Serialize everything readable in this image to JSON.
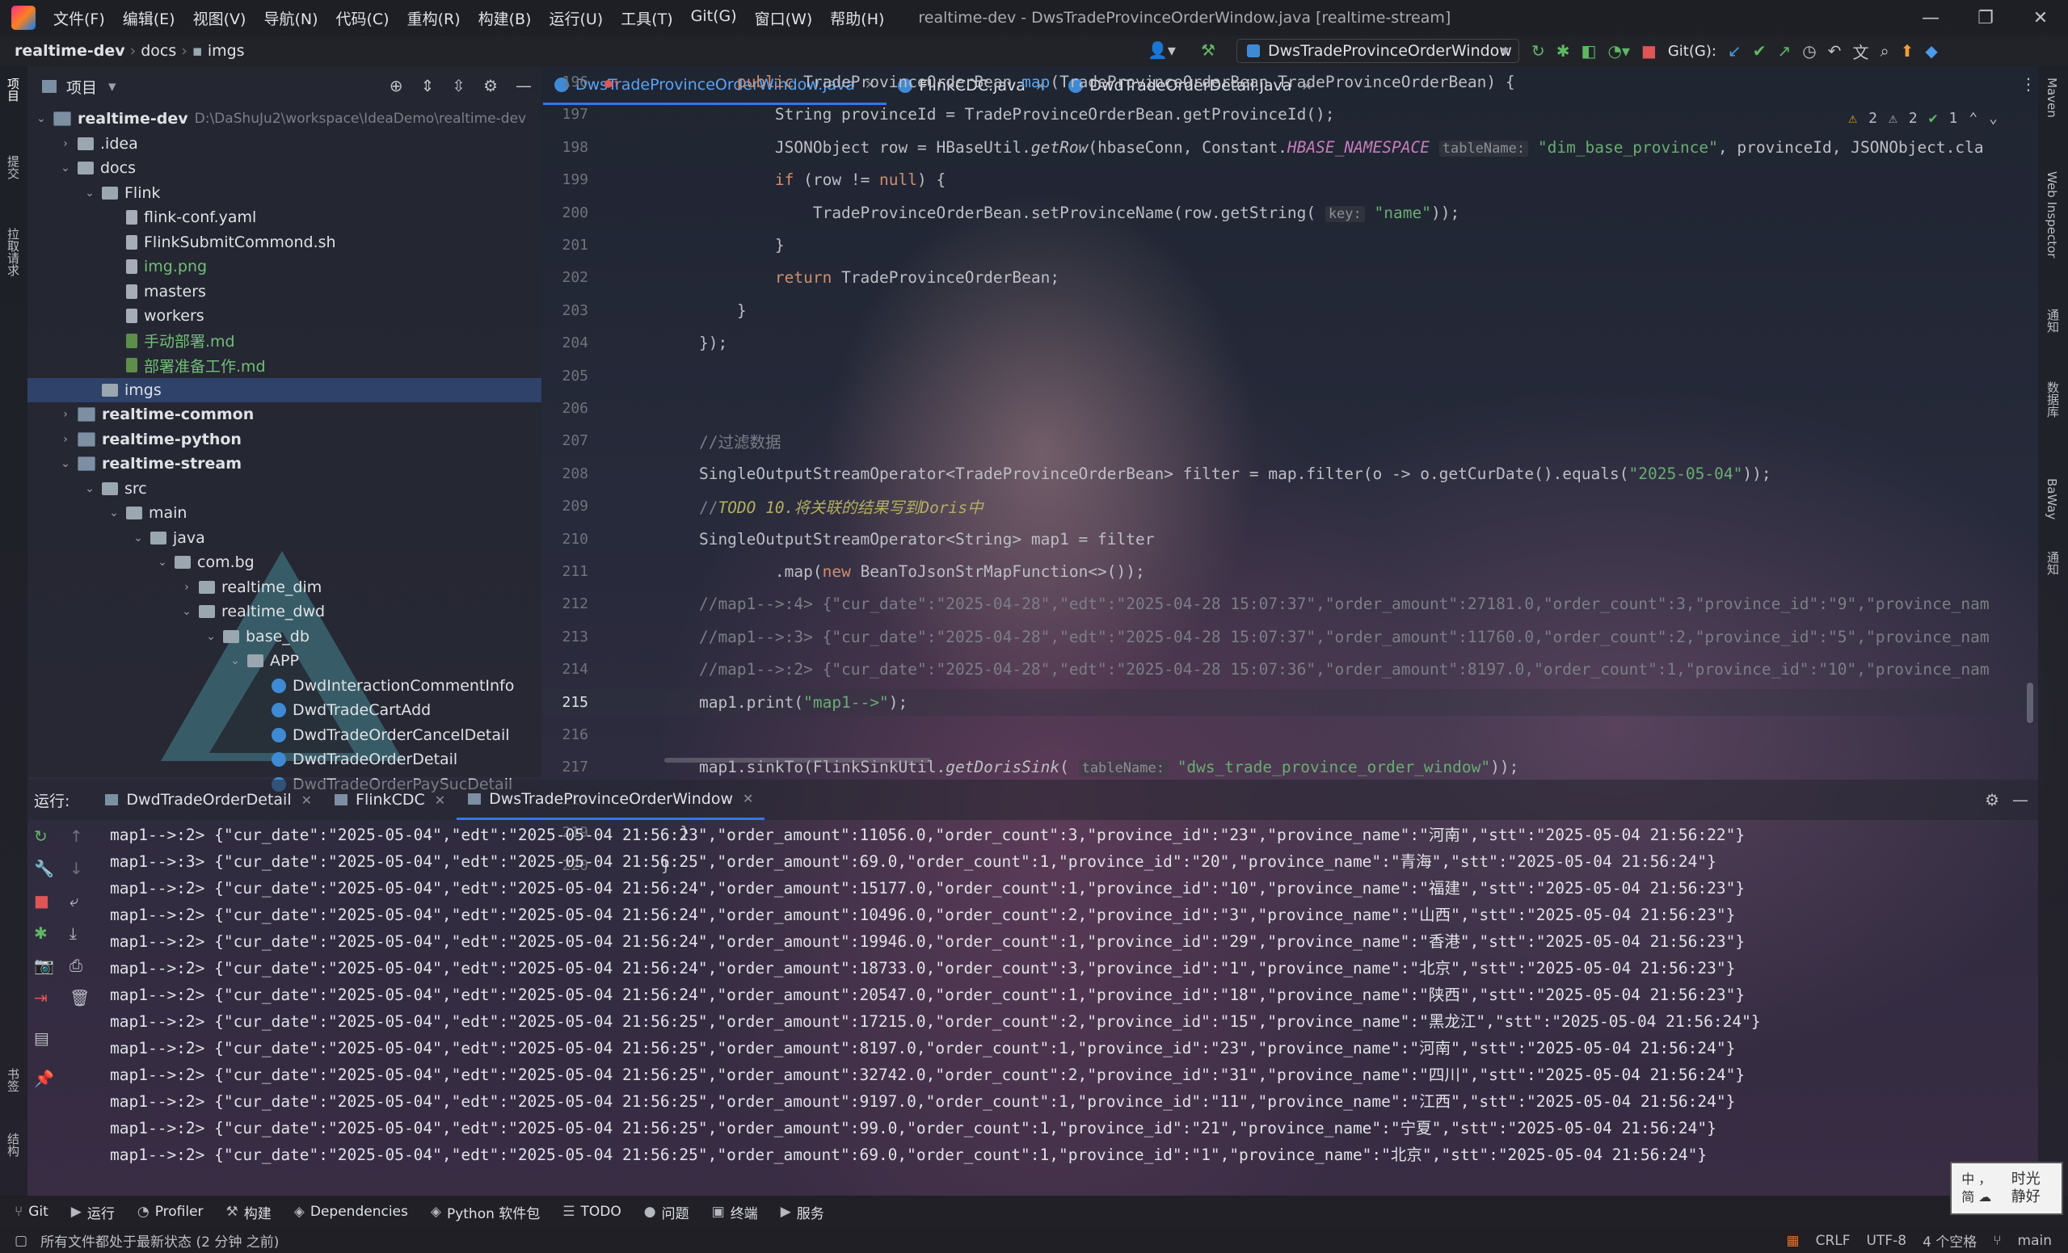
{
  "window": {
    "title": "realtime-dev - DwsTradeProvinceOrderWindow.java [realtime-stream]",
    "menu": [
      "文件(F)",
      "编辑(E)",
      "视图(V)",
      "导航(N)",
      "代码(C)",
      "重构(R)",
      "构建(B)",
      "运行(U)",
      "工具(T)",
      "Git(G)",
      "窗口(W)",
      "帮助(H)"
    ],
    "controls": {
      "minimize": "—",
      "maximize": "❐",
      "close": "✕"
    }
  },
  "navbar": {
    "breadcrumbs": [
      "realtime-dev",
      "docs",
      "imgs"
    ],
    "run_config": "DwsTradeProvinceOrderWindow",
    "git_label": "Git(G):"
  },
  "left_stripe": [
    "项目",
    "提交",
    "拉取请求"
  ],
  "left_stripe_bottom": [
    "书签",
    "结构"
  ],
  "project": {
    "title": "项目",
    "root_path": "D:\\DaShuJu2\\workspace\\IdeaDemo\\realtime-dev",
    "tree": [
      {
        "label": "realtime-dev",
        "kind": "mod",
        "depth": 0,
        "open": true,
        "bold": true
      },
      {
        "label": ".idea",
        "kind": "folder",
        "depth": 1,
        "open": false
      },
      {
        "label": "docs",
        "kind": "folder",
        "depth": 1,
        "open": true
      },
      {
        "label": "Flink",
        "kind": "folder",
        "depth": 2,
        "open": true
      },
      {
        "label": "flink-conf.yaml",
        "kind": "file",
        "depth": 3
      },
      {
        "label": "FlinkSubmitCommond.sh",
        "kind": "file",
        "depth": 3
      },
      {
        "label": "img.png",
        "kind": "file",
        "depth": 3,
        "green": true
      },
      {
        "label": "masters",
        "kind": "file",
        "depth": 3
      },
      {
        "label": "workers",
        "kind": "file",
        "depth": 3
      },
      {
        "label": "手动部署.md",
        "kind": "md",
        "depth": 3,
        "green": true
      },
      {
        "label": "部署准备工作.md",
        "kind": "md",
        "depth": 3,
        "green": true
      },
      {
        "label": "imgs",
        "kind": "folder",
        "depth": 2,
        "selected": true
      },
      {
        "label": "realtime-common",
        "kind": "mod",
        "depth": 1,
        "open": false,
        "bold": true
      },
      {
        "label": "realtime-python",
        "kind": "mod",
        "depth": 1,
        "open": false,
        "bold": true
      },
      {
        "label": "realtime-stream",
        "kind": "mod",
        "depth": 1,
        "open": true,
        "bold": true
      },
      {
        "label": "src",
        "kind": "folder",
        "depth": 2,
        "open": true
      },
      {
        "label": "main",
        "kind": "folder",
        "depth": 3,
        "open": true
      },
      {
        "label": "java",
        "kind": "folder",
        "depth": 4,
        "open": true
      },
      {
        "label": "com.bg",
        "kind": "folder",
        "depth": 5,
        "open": true
      },
      {
        "label": "realtime_dim",
        "kind": "folder",
        "depth": 6,
        "open": false
      },
      {
        "label": "realtime_dwd",
        "kind": "folder",
        "depth": 6,
        "open": true
      },
      {
        "label": "base_db",
        "kind": "folder",
        "depth": 7,
        "open": true
      },
      {
        "label": "APP",
        "kind": "folder",
        "depth": 8,
        "open": true
      },
      {
        "label": "DwdInteractionCommentInfo",
        "kind": "cls",
        "depth": 9
      },
      {
        "label": "DwdTradeCartAdd",
        "kind": "cls",
        "depth": 9
      },
      {
        "label": "DwdTradeOrderCancelDetail",
        "kind": "cls",
        "depth": 9
      },
      {
        "label": "DwdTradeOrderDetail",
        "kind": "cls",
        "depth": 9
      },
      {
        "label": "DwdTradeOrderPaySucDetail",
        "kind": "cls",
        "depth": 9
      }
    ]
  },
  "editor": {
    "tabs": [
      {
        "label": "DwsTradeProvinceOrderWindow.java",
        "active": true
      },
      {
        "label": "FlinkCDC.java",
        "active": false
      },
      {
        "label": "DwdTradeOrderDetail.java",
        "active": false
      }
    ],
    "inspections": {
      "warnings": "2",
      "weak_warnings": "2",
      "ok": "1"
    },
    "lines": [
      {
        "n": "196",
        "segs": [
          [
            "",
            "        "
          ],
          [
            "kw",
            "public "
          ],
          [
            "",
            "TradeProvinceOrderBean "
          ],
          [
            "fn",
            "map"
          ],
          [
            "",
            "(TradeProvinceOrderBean TradeProvinceOrderBean) {"
          ]
        ]
      },
      {
        "n": "197",
        "segs": [
          [
            "",
            "            String provinceId = TradeProvinceOrderBean.getProvinceId();"
          ]
        ]
      },
      {
        "n": "198",
        "segs": [
          [
            "",
            "            JSONObject row = HBaseUtil."
          ],
          [
            "it",
            "getRow"
          ],
          [
            "",
            "(hbaseConn, Constant."
          ],
          [
            "st",
            "HBASE_NAMESPACE"
          ],
          [
            ",",
            " "
          ],
          [
            "hint",
            "tableName:"
          ],
          [
            "",
            " "
          ],
          [
            "str",
            "\"dim_base_province\""
          ],
          [
            "",
            ", provinceId, JSONObject.cla"
          ]
        ]
      },
      {
        "n": "199",
        "segs": [
          [
            "",
            "            "
          ],
          [
            "kw",
            "if "
          ],
          [
            "",
            "(row != "
          ],
          [
            "kw",
            "null"
          ],
          [
            "",
            ") {"
          ]
        ]
      },
      {
        "n": "200",
        "segs": [
          [
            "",
            "                TradeProvinceOrderBean.setProvinceName(row.getString( "
          ],
          [
            "hint",
            "key:"
          ],
          [
            "",
            " "
          ],
          [
            "str",
            "\"name\""
          ],
          [
            "",
            "));"
          ]
        ]
      },
      {
        "n": "201",
        "segs": [
          [
            "",
            "            }"
          ]
        ]
      },
      {
        "n": "202",
        "segs": [
          [
            "",
            "            "
          ],
          [
            "kw",
            "return "
          ],
          [
            "",
            "TradeProvinceOrderBean;"
          ]
        ]
      },
      {
        "n": "203",
        "segs": [
          [
            "",
            "        }"
          ]
        ]
      },
      {
        "n": "204",
        "segs": [
          [
            "",
            "    });"
          ]
        ]
      },
      {
        "n": "205",
        "segs": []
      },
      {
        "n": "206",
        "segs": []
      },
      {
        "n": "207",
        "segs": [
          [
            "cm",
            "    //过滤数据"
          ]
        ]
      },
      {
        "n": "208",
        "segs": [
          [
            "",
            "    SingleOutputStreamOperator<TradeProvinceOrderBean> filter = map.filter(o -> o.getCurDate().equals("
          ],
          [
            "str",
            "\"2025-05-04\""
          ],
          [
            "",
            "));"
          ]
        ]
      },
      {
        "n": "209",
        "segs": [
          [
            "cm",
            "    //"
          ],
          [
            "todo",
            "TODO 10.将关联的结果写到Doris中"
          ]
        ]
      },
      {
        "n": "210",
        "segs": [
          [
            "",
            "    SingleOutputStreamOperator<String> map1 = filter"
          ]
        ]
      },
      {
        "n": "211",
        "segs": [
          [
            "",
            "            .map("
          ],
          [
            "kw",
            "new "
          ],
          [
            "",
            "BeanToJsonStrMapFunction<>());"
          ]
        ]
      },
      {
        "n": "212",
        "segs": [
          [
            "cm",
            "    //map1-->:4> {\"cur_date\":\"2025-04-28\",\"edt\":\"2025-04-28 15:07:37\",\"order_amount\":27181.0,\"order_count\":3,\"province_id\":\"9\",\"province_nam"
          ]
        ]
      },
      {
        "n": "213",
        "segs": [
          [
            "cm",
            "    //map1-->:3> {\"cur_date\":\"2025-04-28\",\"edt\":\"2025-04-28 15:07:37\",\"order_amount\":11760.0,\"order_count\":2,\"province_id\":\"5\",\"province_nam"
          ]
        ]
      },
      {
        "n": "214",
        "segs": [
          [
            "cm",
            "    //map1-->:2> {\"cur_date\":\"2025-04-28\",\"edt\":\"2025-04-28 15:07:36\",\"order_amount\":8197.0,\"order_count\":1,\"province_id\":\"10\",\"province_nam"
          ]
        ]
      },
      {
        "n": "215",
        "segs": [
          [
            "",
            "    map1.print("
          ],
          [
            "str",
            "\"map1-->\""
          ],
          [
            "",
            ");"
          ]
        ]
      },
      {
        "n": "216",
        "segs": []
      },
      {
        "n": "217",
        "segs": [
          [
            "",
            "    map1.sinkTo(FlinkSinkUtil."
          ],
          [
            "it",
            "getDorisSink"
          ],
          [
            "",
            "( "
          ],
          [
            "hint",
            "tableName:"
          ],
          [
            "",
            " "
          ],
          [
            "str",
            "\"dws_trade_province_order_window\""
          ],
          [
            "",
            "));"
          ]
        ]
      },
      {
        "n": "218",
        "segs": []
      },
      {
        "n": "219",
        "segs": [
          [
            "",
            "  }"
          ]
        ]
      },
      {
        "n": "220",
        "segs": [
          [
            "",
            "}"
          ]
        ]
      }
    ]
  },
  "run": {
    "label": "运行:",
    "tabs": [
      {
        "label": "DwdTradeOrderDetail",
        "active": false
      },
      {
        "label": "FlinkCDC",
        "active": false
      },
      {
        "label": "DwsTradeProvinceOrderWindow",
        "active": true
      }
    ],
    "output": [
      "map1-->:2> {\"cur_date\":\"2025-05-04\",\"edt\":\"2025-05-04 21:56:23\",\"order_amount\":11056.0,\"order_count\":3,\"province_id\":\"23\",\"province_name\":\"河南\",\"stt\":\"2025-05-04 21:56:22\"}",
      "map1-->:3> {\"cur_date\":\"2025-05-04\",\"edt\":\"2025-05-04 21:56:25\",\"order_amount\":69.0,\"order_count\":1,\"province_id\":\"20\",\"province_name\":\"青海\",\"stt\":\"2025-05-04 21:56:24\"}",
      "map1-->:2> {\"cur_date\":\"2025-05-04\",\"edt\":\"2025-05-04 21:56:24\",\"order_amount\":15177.0,\"order_count\":1,\"province_id\":\"10\",\"province_name\":\"福建\",\"stt\":\"2025-05-04 21:56:23\"}",
      "map1-->:2> {\"cur_date\":\"2025-05-04\",\"edt\":\"2025-05-04 21:56:24\",\"order_amount\":10496.0,\"order_count\":2,\"province_id\":\"3\",\"province_name\":\"山西\",\"stt\":\"2025-05-04 21:56:23\"}",
      "map1-->:2> {\"cur_date\":\"2025-05-04\",\"edt\":\"2025-05-04 21:56:24\",\"order_amount\":19946.0,\"order_count\":1,\"province_id\":\"29\",\"province_name\":\"香港\",\"stt\":\"2025-05-04 21:56:23\"}",
      "map1-->:2> {\"cur_date\":\"2025-05-04\",\"edt\":\"2025-05-04 21:56:24\",\"order_amount\":18733.0,\"order_count\":3,\"province_id\":\"1\",\"province_name\":\"北京\",\"stt\":\"2025-05-04 21:56:23\"}",
      "map1-->:2> {\"cur_date\":\"2025-05-04\",\"edt\":\"2025-05-04 21:56:24\",\"order_amount\":20547.0,\"order_count\":1,\"province_id\":\"18\",\"province_name\":\"陕西\",\"stt\":\"2025-05-04 21:56:23\"}",
      "map1-->:2> {\"cur_date\":\"2025-05-04\",\"edt\":\"2025-05-04 21:56:25\",\"order_amount\":17215.0,\"order_count\":2,\"province_id\":\"15\",\"province_name\":\"黑龙江\",\"stt\":\"2025-05-04 21:56:24\"}",
      "map1-->:2> {\"cur_date\":\"2025-05-04\",\"edt\":\"2025-05-04 21:56:25\",\"order_amount\":8197.0,\"order_count\":1,\"province_id\":\"23\",\"province_name\":\"河南\",\"stt\":\"2025-05-04 21:56:24\"}",
      "map1-->:2> {\"cur_date\":\"2025-05-04\",\"edt\":\"2025-05-04 21:56:25\",\"order_amount\":32742.0,\"order_count\":2,\"province_id\":\"31\",\"province_name\":\"四川\",\"stt\":\"2025-05-04 21:56:24\"}",
      "map1-->:2> {\"cur_date\":\"2025-05-04\",\"edt\":\"2025-05-04 21:56:25\",\"order_amount\":9197.0,\"order_count\":1,\"province_id\":\"11\",\"province_name\":\"江西\",\"stt\":\"2025-05-04 21:56:24\"}",
      "map1-->:2> {\"cur_date\":\"2025-05-04\",\"edt\":\"2025-05-04 21:56:25\",\"order_amount\":99.0,\"order_count\":1,\"province_id\":\"21\",\"province_name\":\"宁夏\",\"stt\":\"2025-05-04 21:56:24\"}",
      "map1-->:2> {\"cur_date\":\"2025-05-04\",\"edt\":\"2025-05-04 21:56:25\",\"order_amount\":69.0,\"order_count\":1,\"province_id\":\"1\",\"province_name\":\"北京\",\"stt\":\"2025-05-04 21:56:24\"}"
    ]
  },
  "bottom_tools": [
    {
      "icon": "⑂",
      "label": "Git"
    },
    {
      "icon": "▶",
      "label": "运行"
    },
    {
      "icon": "◔",
      "label": "Profiler"
    },
    {
      "icon": "⚒",
      "label": "构建"
    },
    {
      "icon": "◈",
      "label": "Dependencies"
    },
    {
      "icon": "◈",
      "label": "Python 软件包"
    },
    {
      "icon": "☰",
      "label": "TODO"
    },
    {
      "icon": "●",
      "label": "问题"
    },
    {
      "icon": "▣",
      "label": "终端"
    },
    {
      "icon": "▶",
      "label": "服务"
    }
  ],
  "status": {
    "message": "所有文件都处于最新状态 (2 分钟 之前)",
    "line_sep": "CRLF",
    "encoding": "UTF-8",
    "indent": "4 个空格",
    "branch": "main"
  },
  "right_stripe": [
    "Maven",
    "Web Inspector",
    "通知",
    "数据库",
    "BaWay",
    "通知"
  ],
  "ime": {
    "line1": "中 ，",
    "line2": "简 ☁",
    "brand": "时光 静好"
  }
}
